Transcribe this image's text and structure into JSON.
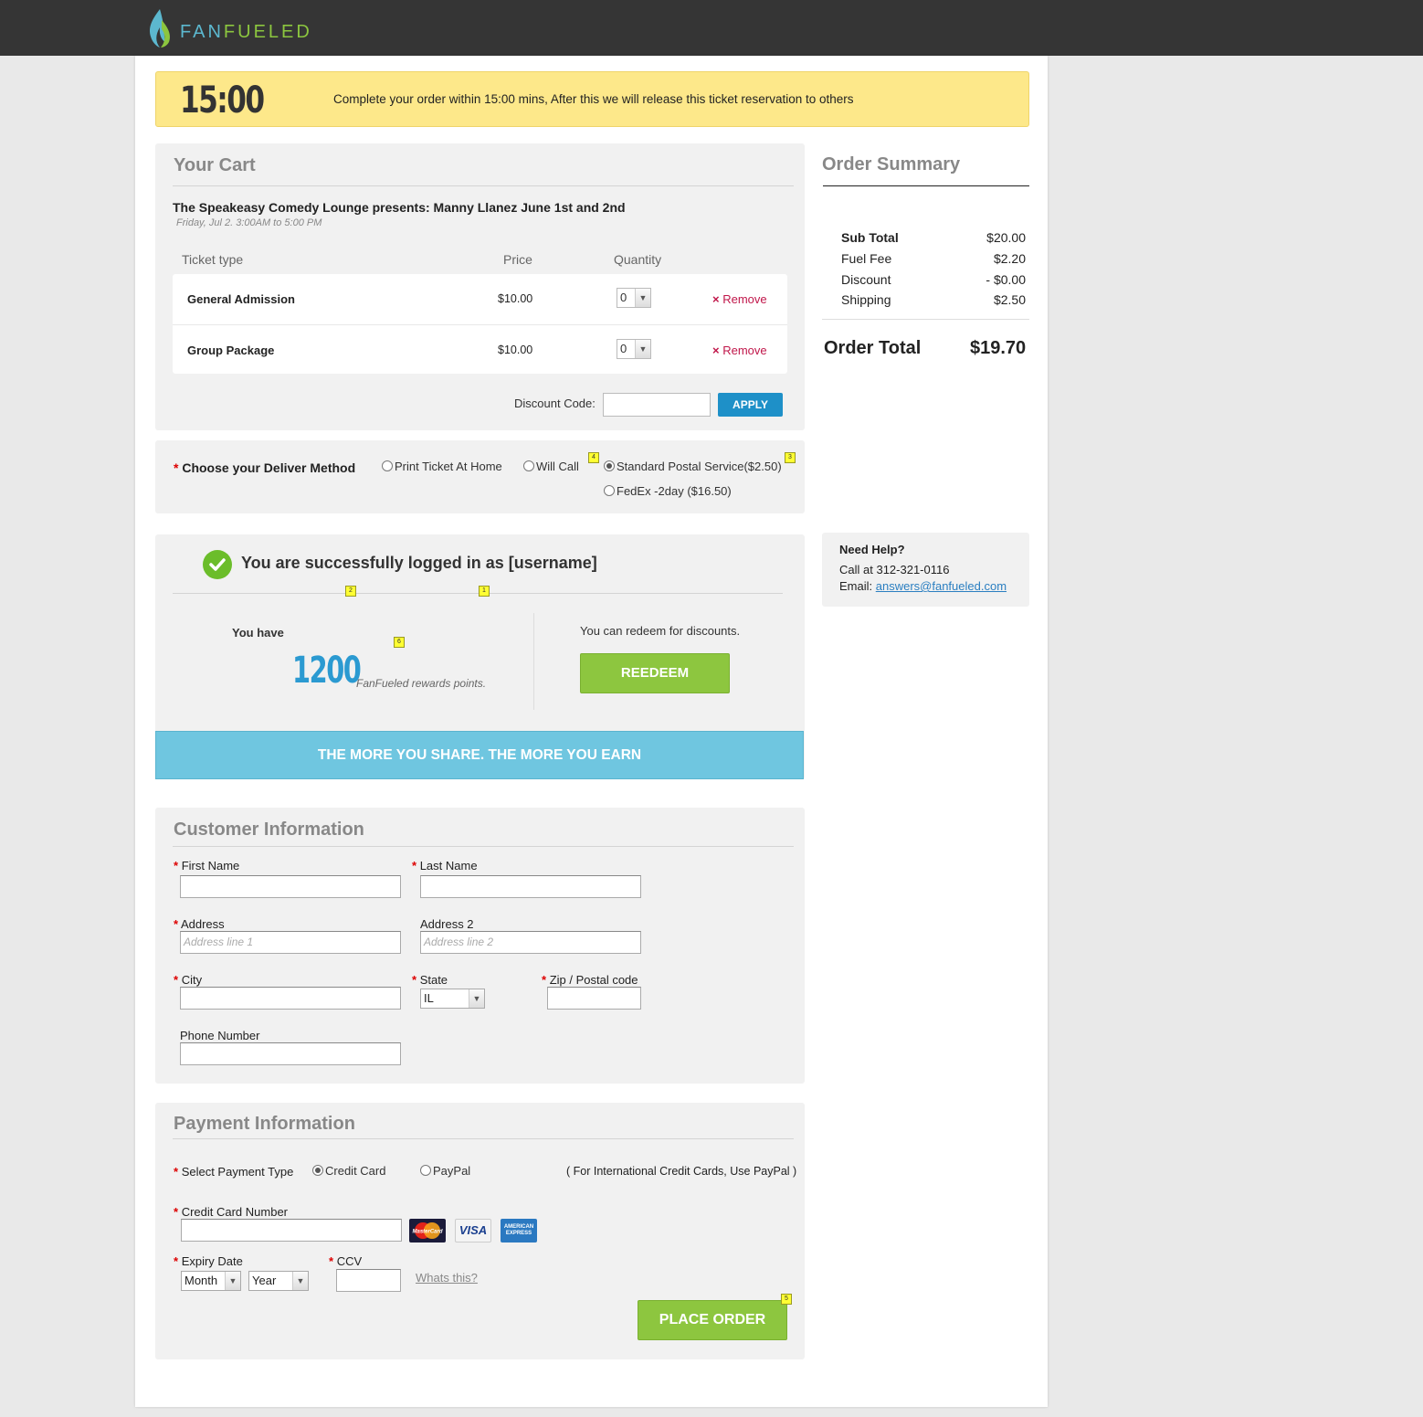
{
  "brand": {
    "name_part1": "FAN",
    "name_part2": "FUELED"
  },
  "timer": {
    "countdown": "15:00",
    "message": "Complete your order within 15:00 mins, After this we will release this ticket reservation to others"
  },
  "cart": {
    "title": "Your Cart",
    "event_title": "The Speakeasy Comedy Lounge presents: Manny Llanez June 1st and 2nd",
    "event_date": "Friday, Jul 2. 3:00AM to 5:00 PM",
    "headers": {
      "ticket_type": "Ticket type",
      "price": "Price",
      "quantity": "Quantity"
    },
    "rows": [
      {
        "name": "General Admission",
        "price": "$10.00",
        "qty": "0",
        "remove": "Remove"
      },
      {
        "name": "Group Package",
        "price": "$10.00",
        "qty": "0",
        "remove": "Remove"
      }
    ],
    "discount_label": "Discount Code:",
    "discount_value": "",
    "apply_label": "APPLY"
  },
  "delivery": {
    "required_mark": "*",
    "label": "Choose your Deliver Method",
    "options": [
      {
        "label": "Print Ticket At Home",
        "selected": false
      },
      {
        "label": "Will Call",
        "selected": false
      },
      {
        "label": "Standard Postal Service($2.50)",
        "selected": true
      },
      {
        "label": "FedEx -2day ($16.50)",
        "selected": false
      }
    ]
  },
  "notes": [
    "1",
    "2",
    "3",
    "4",
    "5",
    "6"
  ],
  "rewards": {
    "login_message": "You are successfully logged in as [username]",
    "you_have": "You have",
    "points": "1200",
    "points_label": "FanFueled rewards points.",
    "redeem_text": "You can redeem for discounts.",
    "redeem_button": "REEDEEM",
    "banner": "THE MORE YOU SHARE. THE MORE YOU EARN"
  },
  "customer": {
    "title": "Customer Information",
    "required_mark": "*",
    "first_name_label": "First Name",
    "last_name_label": "Last Name",
    "address_label": "Address",
    "address_placeholder": "Address line 1",
    "address2_label": "Address 2",
    "address2_placeholder": "Address line 2",
    "city_label": "City",
    "state_label": "State",
    "state_value": "IL",
    "zip_label": "Zip / Postal code",
    "phone_label": "Phone Number"
  },
  "payment": {
    "title": "Payment Information",
    "required_mark": "*",
    "type_label": "Select Payment Type",
    "options": [
      {
        "label": "Credit Card",
        "selected": true
      },
      {
        "label": "PayPal",
        "selected": false
      }
    ],
    "intl_note": "( For International Credit Cards, Use PayPal )",
    "card_number_label": "Credit Card Number",
    "cards": [
      "MasterCard",
      "VISA",
      "AMERICAN EXPRESS"
    ],
    "expiry_label": "Expiry Date",
    "month_value": "Month",
    "year_value": "Year",
    "ccv_label": "CCV",
    "whats_this": "Whats this?",
    "place_order": "PLACE ORDER"
  },
  "summary": {
    "title": "Order Summary",
    "rows": [
      {
        "label": "Sub Total",
        "value": "$20.00"
      },
      {
        "label": "Fuel Fee",
        "value": "$2.20"
      },
      {
        "label": "Discount",
        "value": "- $0.00"
      },
      {
        "label": "Shipping",
        "value": "$2.50"
      }
    ],
    "total_label": "Order Total",
    "total_value": "$19.70"
  },
  "help": {
    "title": "Need Help?",
    "call": "Call at 312-321-0116",
    "email_label": "Email:",
    "email": "answers@fanfueled.com"
  },
  "colors": {
    "topbar": "#353535",
    "timer_bg": "#fde88a",
    "accent_blue": "#1e90c8",
    "accent_green": "#8dc63f",
    "banner_blue": "#6fc6e0",
    "remove_red": "#c0164a"
  }
}
